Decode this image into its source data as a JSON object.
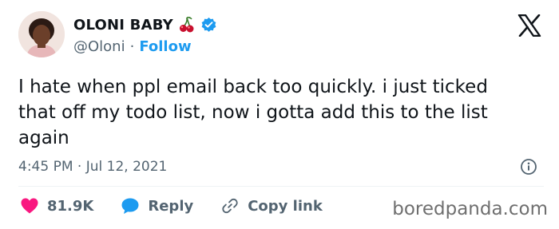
{
  "author": {
    "display_name": "OLONI BABY",
    "badge_emoji_icon": "cherry-icon",
    "verified_icon": "verified-badge-icon",
    "handle": "@Oloni",
    "separator": "·",
    "follow_label": "Follow"
  },
  "platform_logo": "x-logo-icon",
  "tweet": {
    "text": "I hate when ppl email back too quickly. i just ticked\nthat off my todo list, now i gotta add this to the list\nagain",
    "timestamp": "4:45 PM · Jul 12, 2021"
  },
  "actions": {
    "likes_count": "81.9K",
    "reply_label": "Reply",
    "copy_link_label": "Copy link"
  },
  "watermark": "boredpanda.com",
  "colors": {
    "text": "#0f1419",
    "secondary": "#536471",
    "accent": "#1d9bf0",
    "heart": "#f91880",
    "cherry": "#c8102e"
  }
}
